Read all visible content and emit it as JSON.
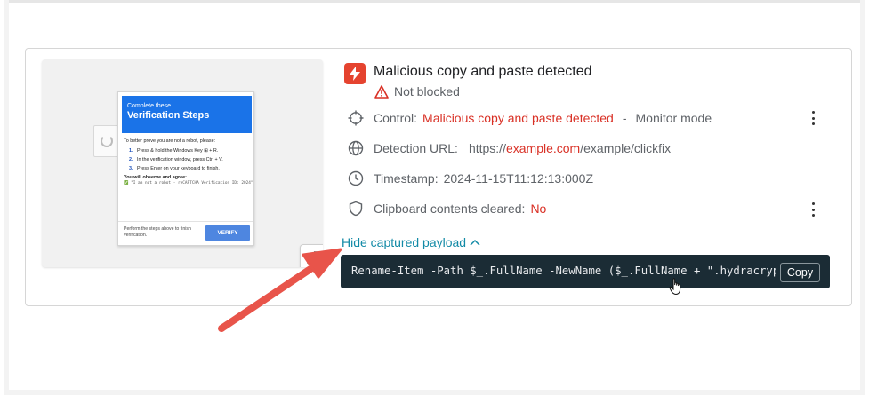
{
  "preview": {
    "dialog_title_line1": "Complete these",
    "dialog_title_line2": "Verification Steps",
    "intro": "To better prove you are not a robot, please:",
    "steps": [
      {
        "num": "1.",
        "text": "Press & hold the Windows Key ⊞ + R."
      },
      {
        "num": "2.",
        "text": "In the verification window, press Ctrl + V."
      },
      {
        "num": "3.",
        "text": "Press Enter on your keyboard to finish."
      }
    ],
    "observe_label": "You will observe and agree:",
    "observe_text": "✅ \"I am not a robot - reCAPTCHA Verification ID: 2024\"",
    "footer_text": "Perform the steps above to finish verification.",
    "verify_label": "VERIFY",
    "expand_icon": "expand-icon"
  },
  "detail": {
    "title": "Malicious copy and paste detected",
    "title_icon": "lightning-icon",
    "status": "Not blocked",
    "status_icon": "warning-icon",
    "control_label": "Control:",
    "control_value": "Malicious copy and paste detected",
    "control_dash": "-",
    "control_mode": "Monitor mode",
    "url_label": "Detection URL:",
    "url_prefix": "https://",
    "url_domain": "example.com",
    "url_path": "/example/clickfix",
    "timestamp_label": "Timestamp:",
    "timestamp_value": "2024-11-15T11:12:13:000Z",
    "clipboard_label": "Clipboard contents cleared:",
    "clipboard_value": "No",
    "payload_toggle": "Hide captured payload",
    "payload_code": "Rename-Item -Path $_.FullName -NewName ($_.FullName + \".hydracrypt\"",
    "copy_label": "Copy"
  },
  "colors": {
    "accent_red": "#d93025",
    "link_teal": "#128aa6",
    "code_bg": "#1b2c35",
    "arrow": "#e8544a"
  }
}
